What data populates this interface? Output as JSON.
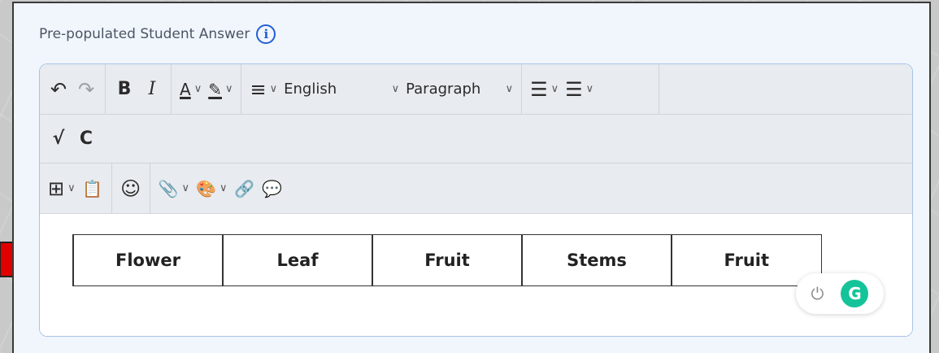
{
  "section": {
    "label": "Pre-populated Student Answer",
    "info_icon": "i"
  },
  "toolbar": {
    "undo": "↶",
    "redo": "↷",
    "bold": "B",
    "italic": "I",
    "font_color": "A",
    "highlight": "✎",
    "align": "≡",
    "language": "English",
    "block_format": "Paragraph",
    "numbered_list": "☰",
    "bullet_list": "☰",
    "math": "√",
    "chem": "C",
    "table": "⊞",
    "paste_text": "📋",
    "emoji": "☺",
    "attach": "📎",
    "palette": "🎨",
    "link": "🔗",
    "comment": "💬",
    "chevron": "∨"
  },
  "content": {
    "table_cells": [
      "Flower",
      "Leaf",
      "Fruit",
      "Stems",
      "Fruit"
    ]
  },
  "grammarly": {
    "power_icon": "⏻",
    "logo": "G"
  },
  "colors": {
    "accent": "#1f5fd6",
    "arrow": "#e00000",
    "grammarly": "#15c39a"
  }
}
